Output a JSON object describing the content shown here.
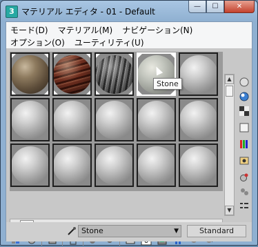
{
  "window": {
    "title": "マテリアル エディタ - 01 - Default",
    "app_icon_label": "3",
    "buttons": {
      "minimize": "—",
      "maximize": "☐",
      "close": "✕"
    }
  },
  "menubar": {
    "row1": [
      "モード(D)",
      "マテリアル(M)",
      "ナビゲーション(N)"
    ],
    "row2": [
      "オプション(O)",
      "ユーティリティ(U)"
    ]
  },
  "slots": [
    {
      "material": "rock"
    },
    {
      "material": "wood"
    },
    {
      "material": "bark"
    },
    {
      "material": "stone",
      "active": true
    },
    {
      "material": "default"
    },
    {
      "material": "default"
    },
    {
      "material": "default"
    },
    {
      "material": "default"
    },
    {
      "material": "default"
    },
    {
      "material": "default"
    },
    {
      "material": "default"
    },
    {
      "material": "default"
    },
    {
      "material": "default"
    },
    {
      "material": "default"
    },
    {
      "material": "default"
    }
  ],
  "tooltip": "Stone",
  "scroll": {
    "up": "▲",
    "down": "▼"
  },
  "sidebar_icons": [
    "sample-type-icon",
    "backlight-icon",
    "background-checker-icon",
    "uv-tiling-icon",
    "video-color-check-icon",
    "make-preview-icon",
    "options-icon",
    "select-by-material-icon",
    "material-map-navigator-icon"
  ],
  "toolbar_icons": [
    "get-material-icon",
    "put-to-scene-icon",
    "assign-to-selection-icon",
    "reset-icon",
    "copy-material-icon",
    "make-unique-icon",
    "put-to-library-icon",
    "material-id-channel-icon",
    "show-map-in-viewport-icon",
    "show-end-result-icon",
    "go-to-parent-icon",
    "go-forward-sibling-icon"
  ],
  "material_id": "0",
  "bottom": {
    "material_name": "Stone",
    "material_type": "Standard"
  }
}
